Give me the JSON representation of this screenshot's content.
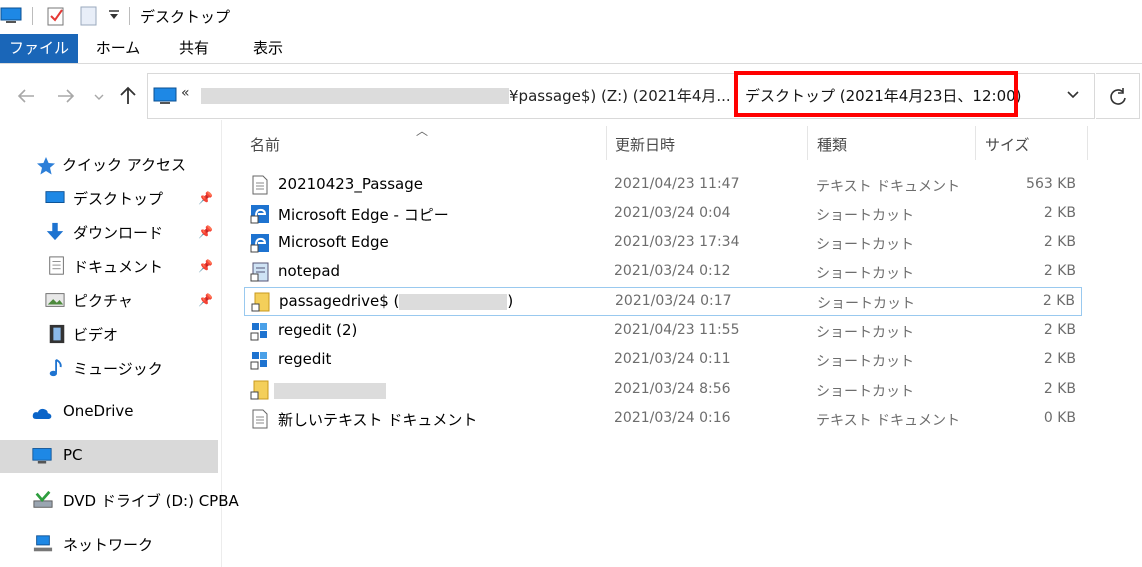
{
  "window": {
    "title": "デスクトップ"
  },
  "ribbon": {
    "tabs": [
      "ファイル",
      "ホーム",
      "共有",
      "表示"
    ]
  },
  "address": {
    "path_visible": "¥passage$) (Z:) (2021年4月...",
    "current_folder": "デスクトップ (2021年4月23日、12:00)"
  },
  "nav": {
    "items": [
      {
        "label": "クイック アクセス",
        "icon": "star-icon"
      },
      {
        "label": "デスクトップ",
        "icon": "desktop-icon",
        "pinned": true
      },
      {
        "label": "ダウンロード",
        "icon": "download-icon",
        "pinned": true
      },
      {
        "label": "ドキュメント",
        "icon": "document-icon",
        "pinned": true
      },
      {
        "label": "ピクチャ",
        "icon": "pictures-icon",
        "pinned": true
      },
      {
        "label": "ビデオ",
        "icon": "video-icon"
      },
      {
        "label": "ミュージック",
        "icon": "music-icon"
      },
      {
        "label": "OneDrive",
        "icon": "cloud-icon"
      },
      {
        "label": "PC",
        "icon": "pc-icon",
        "selected": true
      },
      {
        "label": "DVD ドライブ (D:) CPBA",
        "icon": "dvd-drive-icon"
      },
      {
        "label": "ネットワーク",
        "icon": "network-icon"
      }
    ]
  },
  "columns": {
    "name": "名前",
    "date": "更新日時",
    "type": "種類",
    "size": "サイズ"
  },
  "files": [
    {
      "name": "20210423_Passage",
      "date": "2021/04/23 11:47",
      "type": "テキスト ドキュメント",
      "size": "563 KB",
      "icon": "text-file-icon"
    },
    {
      "name": "Microsoft Edge - コピー",
      "date": "2021/03/24 0:04",
      "type": "ショートカット",
      "size": "2 KB",
      "icon": "edge-shortcut-icon"
    },
    {
      "name": "Microsoft Edge",
      "date": "2021/03/23 17:34",
      "type": "ショートカット",
      "size": "2 KB",
      "icon": "edge-shortcut-icon"
    },
    {
      "name": "notepad",
      "date": "2021/03/24 0:12",
      "type": "ショートカット",
      "size": "2 KB",
      "icon": "notepad-shortcut-icon"
    },
    {
      "name_prefix": "passagedrive$ (",
      "name_suffix": ")",
      "date": "2021/03/24 0:17",
      "type": "ショートカット",
      "size": "2 KB",
      "icon": "folder-shortcut-icon",
      "focused": true
    },
    {
      "name": "regedit (2)",
      "date": "2021/04/23 11:55",
      "type": "ショートカット",
      "size": "2 KB",
      "icon": "regedit-shortcut-icon"
    },
    {
      "name": "regedit",
      "date": "2021/03/24 0:11",
      "type": "ショートカット",
      "size": "2 KB",
      "icon": "regedit-shortcut-icon"
    },
    {
      "name": "",
      "date": "2021/03/24 8:56",
      "type": "ショートカット",
      "size": "2 KB",
      "icon": "folder-shortcut-icon",
      "redacted": true
    },
    {
      "name": "新しいテキスト ドキュメント",
      "date": "2021/03/24 0:16",
      "type": "テキスト ドキュメント",
      "size": "0 KB",
      "icon": "text-file-icon"
    }
  ],
  "colors": {
    "accent": "#1a66b8",
    "highlight": "#ff0000",
    "selected_nav": "#d9d9d9"
  }
}
